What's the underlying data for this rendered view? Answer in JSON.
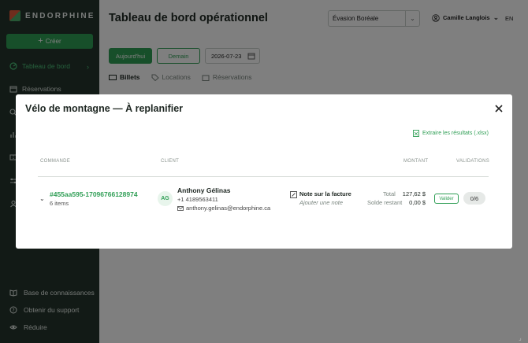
{
  "brand": {
    "name": "ENDORPHINE",
    "accent": "#2f9e55",
    "sidebar_bg": "#24352c"
  },
  "sidebar": {
    "create_label": "Créer",
    "items": [
      {
        "label": "Tableau de bord",
        "icon": "dashboard-icon",
        "active": true
      },
      {
        "label": "Réservations",
        "icon": "calendar-icon",
        "active": false
      }
    ],
    "hidden_icons": [
      "search-icon",
      "chart-icon",
      "ticket-icon",
      "sliders-icon",
      "users-icon"
    ],
    "bottom": [
      {
        "label": "Base de connaissances",
        "icon": "book-icon"
      },
      {
        "label": "Obtenir du support",
        "icon": "help-icon"
      },
      {
        "label": "Réduire",
        "icon": "eye-icon"
      }
    ]
  },
  "header": {
    "title": "Tableau de bord opérationnel",
    "org_select": "Évasion Boréale",
    "user": "Camille Langlois",
    "lang": "EN"
  },
  "toolbar": {
    "today": "Aujourd'hui",
    "tomorrow": "Demain",
    "date": "2026-07-23"
  },
  "tabs": [
    {
      "label": "Billets",
      "icon": "ticket-icon",
      "active": true
    },
    {
      "label": "Locations",
      "icon": "tag-icon",
      "active": false
    },
    {
      "label": "Réservations",
      "icon": "building-icon",
      "active": false
    }
  ],
  "modal": {
    "title": "Vélo de montagne — À replanifier",
    "export": "Extraire les résultats (.xlsx)",
    "columns": {
      "order": "COMMANDE",
      "client": "CLIENT",
      "amount": "MONTANT",
      "validations": "VALIDATIONS"
    },
    "row": {
      "order_id": "#455aa595-17096766128974",
      "items": "6 items",
      "avatar": "AG",
      "client_name": "Anthony Gélinas",
      "phone": "+1 4189563411",
      "email": "anthony.gelinas@endorphine.ca",
      "note_label": "Note sur la facture",
      "note_placeholder": "Ajouter une note",
      "total_label": "Total",
      "total_value": "127,62 $",
      "balance_label": "Solde restant",
      "balance_value": "0,00 $",
      "validate": "Valider",
      "validations": "0/6"
    }
  }
}
